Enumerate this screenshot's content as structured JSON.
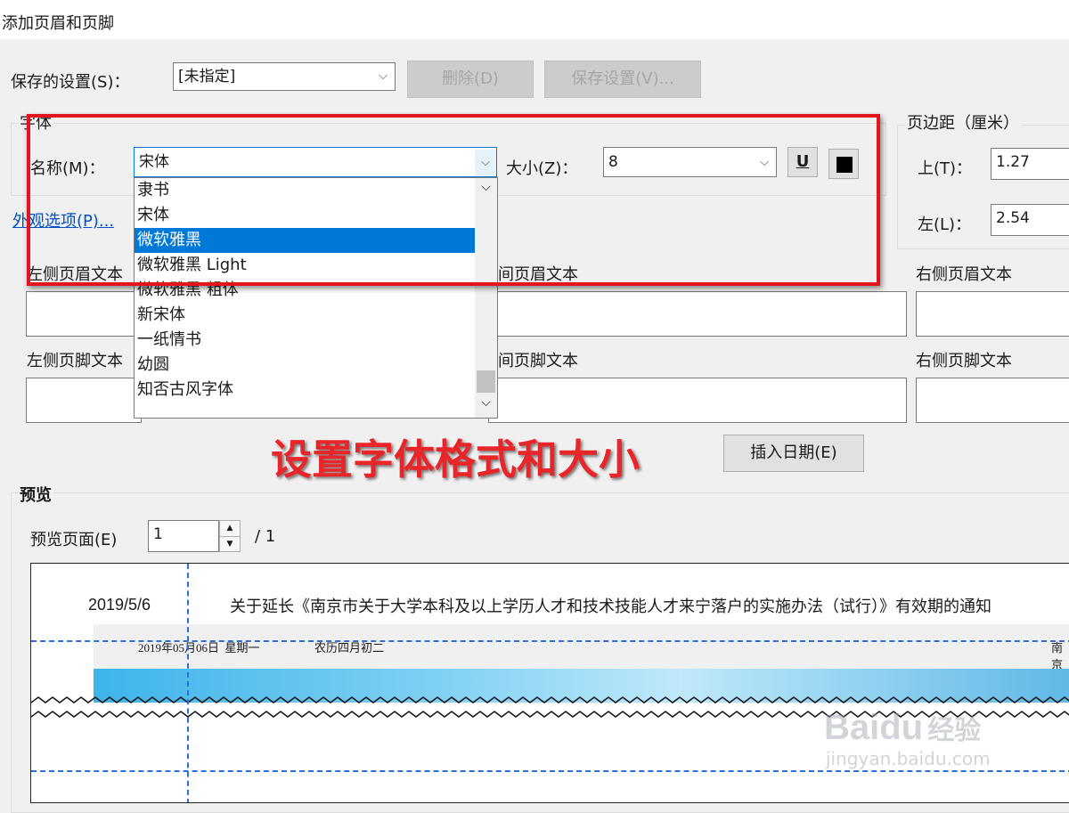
{
  "window": {
    "title": "添加页眉和页脚"
  },
  "saved_settings": {
    "label": "保存的设置(S)：",
    "value": "[未指定]",
    "delete_label": "删除(D)",
    "save_label": "保存设置(V)..."
  },
  "font": {
    "group_title": "字体",
    "name_label": "名称(M)：",
    "name_value": "宋体",
    "size_label": "大小(Z)：",
    "size_value": "8",
    "underline_label": "U",
    "dropdown_items": [
      {
        "label": "隶书",
        "selected": false
      },
      {
        "label": "宋体",
        "selected": false
      },
      {
        "label": "微软雅黑",
        "selected": true
      },
      {
        "label": "微软雅黑 Light",
        "selected": false
      },
      {
        "label": "微软雅黑 粗体",
        "selected": false
      },
      {
        "label": "新宋体",
        "selected": false
      },
      {
        "label": "一纸情书",
        "selected": false
      },
      {
        "label": "幼圆",
        "selected": false
      },
      {
        "label": "知否古风字体",
        "selected": false
      }
    ]
  },
  "appearance_link": "外观选项(P)...",
  "margins": {
    "group_title": "页边距（厘米）",
    "top_label": "上(T)：",
    "top_value": "1.27",
    "left_label": "左(L)：",
    "left_value": "2.54"
  },
  "header_text": {
    "left_label": "左侧页眉文本",
    "center_label": "间页眉文本",
    "right_label": "右侧页眉文本"
  },
  "footer_text": {
    "left_label": "左侧页脚文本",
    "center_label": "间页脚文本",
    "right_label": "右侧页脚文本"
  },
  "insert_date_label": "插入日期(E)",
  "annotation": {
    "text": "设置字体格式和大小",
    "color": "#e8262a"
  },
  "preview": {
    "group_title": "预览",
    "page_label": "预览页面(E)",
    "page_value": "1",
    "page_total": "/ 1",
    "header_date": "2019/5/6",
    "header_title": "关于延长《南京市关于大学本科及以上学历人才和技术技能人才来宁落户的实施办法（试行）》有效期的通知",
    "banner_date": "2019年05月06日  星期一",
    "banner_lunar": "农历四月初二",
    "banner_right": "南京"
  },
  "watermark": {
    "brand": "Baidu",
    "cn": "经验",
    "url": "jingyan.baidu.com"
  },
  "colors": {
    "selection": "#0078d7",
    "highlight_box": "#e3141b",
    "guide_line": "#2a6fdb"
  }
}
